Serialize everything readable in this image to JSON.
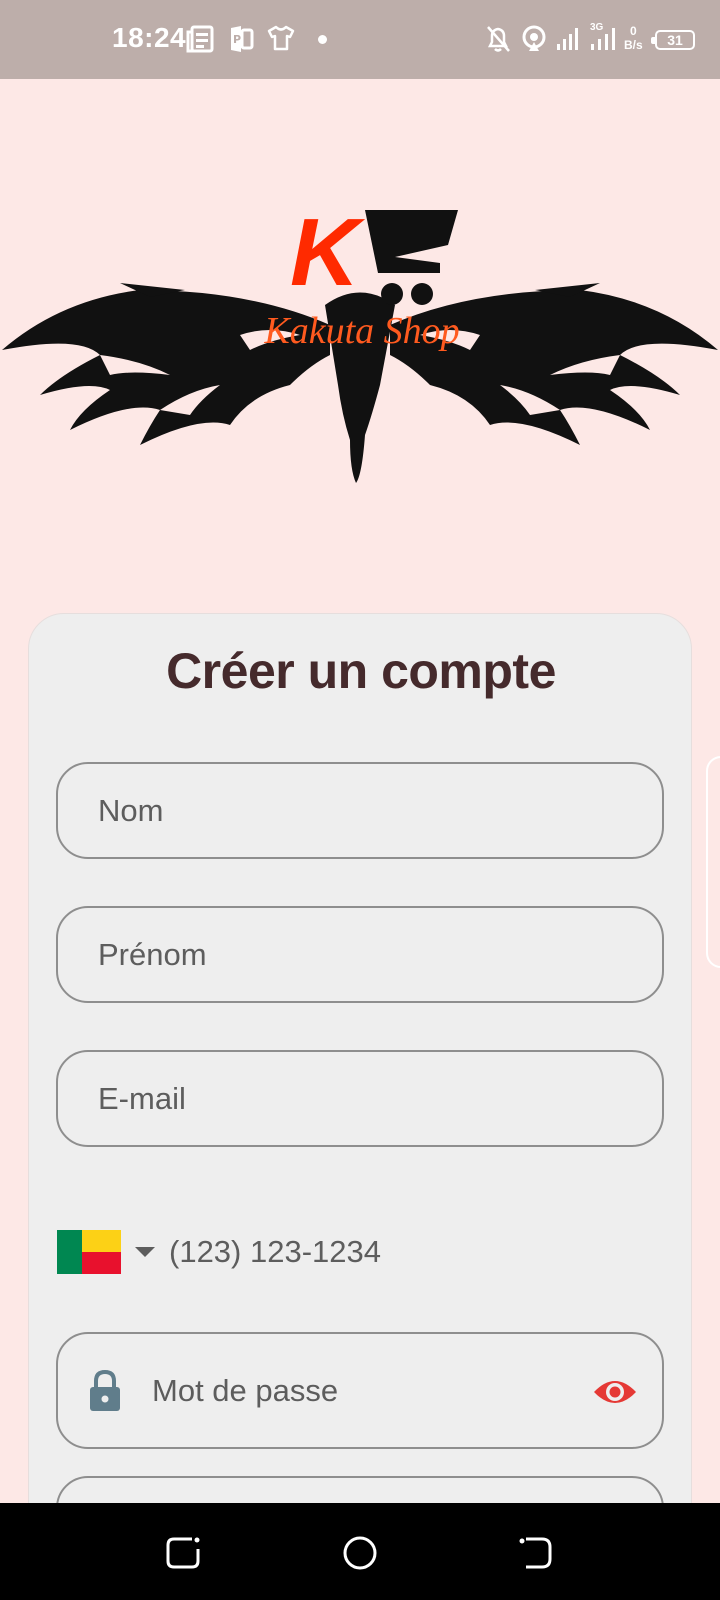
{
  "status_bar": {
    "time": "18:24",
    "net_speed_value": "0",
    "net_speed_unit": "B/s",
    "network_type": "3G",
    "battery_level": "31",
    "icons": [
      "news-icon",
      "pdf-app-icon",
      "tshirt-icon",
      "dot-icon",
      "mute-bell-icon",
      "hotspot-icon",
      "signal-icon",
      "signal-icon"
    ]
  },
  "logo": {
    "letter": "K",
    "brand_name": "Kakuta Shop",
    "brand_color": "#ff2a00",
    "wing_color": "#111111"
  },
  "form": {
    "title": "Créer un compte",
    "fields": {
      "last_name_placeholder": "Nom",
      "first_name_placeholder": "Prénom",
      "email_placeholder": "E-mail",
      "phone_placeholder": "(123) 123-1234",
      "password_placeholder": "Mot de passe"
    },
    "country_flag": "benin-flag-icon",
    "accent_color": "#e53935"
  },
  "nav_bar": {
    "buttons": [
      "recent-apps-icon",
      "home-icon",
      "back-icon"
    ]
  }
}
